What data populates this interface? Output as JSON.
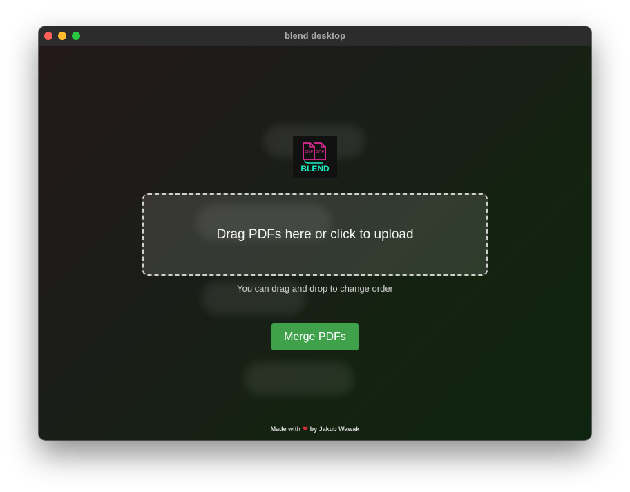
{
  "window": {
    "title": "blend desktop"
  },
  "logo": {
    "badge_left": "PDF",
    "badge_right": "PDF",
    "wordmark": "BLEND"
  },
  "dropzone": {
    "label": "Drag PDFs here or click to upload"
  },
  "hint": "You can drag and drop to change order",
  "merge_button": {
    "label": "Merge PDFs"
  },
  "footer": {
    "prefix": "Made with",
    "heart": "❤",
    "suffix": "by Jakub Wawak"
  },
  "colors": {
    "accent_green": "#3fa24b",
    "logo_pink": "#ff2fa8",
    "logo_cyan": "#18f0c4"
  },
  "icons": {
    "logo": "blend-pdf-logo",
    "heart": "heart-icon"
  }
}
